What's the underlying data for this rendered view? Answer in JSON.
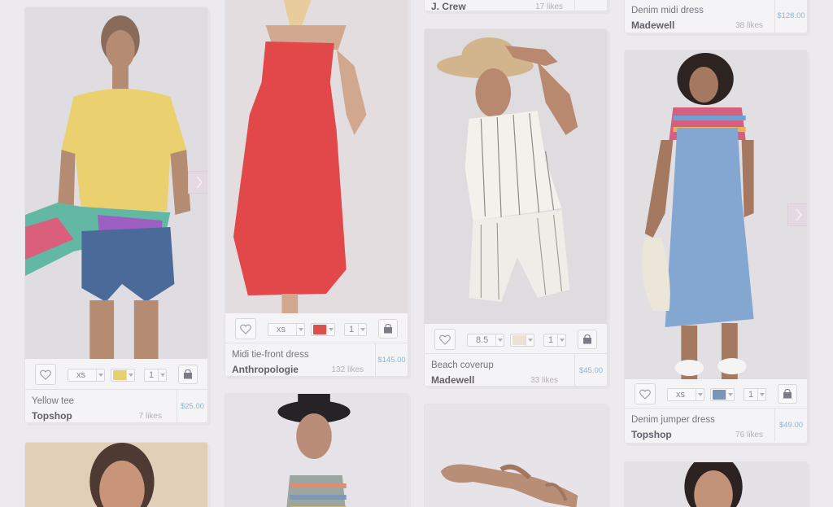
{
  "products": [
    {
      "id": "yellow-tee",
      "name": "Yellow tee",
      "brand": "Topshop",
      "likes": "7 likes",
      "price": "$25.00",
      "size": "xs",
      "color": "#e6cf6e",
      "qty": "1"
    },
    {
      "id": "midi-dress",
      "name": "Midi tie-front dress",
      "brand": "Anthropologie",
      "likes": "132 likes",
      "price": "$145.00",
      "size": "xs",
      "color": "#d9504c",
      "qty": "1"
    },
    {
      "id": "jcrew",
      "brand": "J. Crew",
      "likes": "17 likes"
    },
    {
      "id": "beach-coverup",
      "name": "Beach coverup",
      "brand": "Madewell",
      "likes": "33 likes",
      "price": "$45.00",
      "size": "8.5",
      "color": "#ebe2d2",
      "qty": "1"
    },
    {
      "id": "denim-midi",
      "name": "Denim midi dress",
      "brand": "Madewell",
      "likes": "38 likes",
      "price": "$128.00"
    },
    {
      "id": "jumper-dress",
      "name": "Denim jumper dress",
      "brand": "Topshop",
      "likes": "76 likes",
      "price": "$49.00",
      "size": "xs",
      "color": "#7a95b8",
      "qty": "1"
    }
  ],
  "icons": {
    "heart": "heart-icon",
    "cart": "shopping-bag-icon",
    "next": "chevron-right-icon"
  }
}
